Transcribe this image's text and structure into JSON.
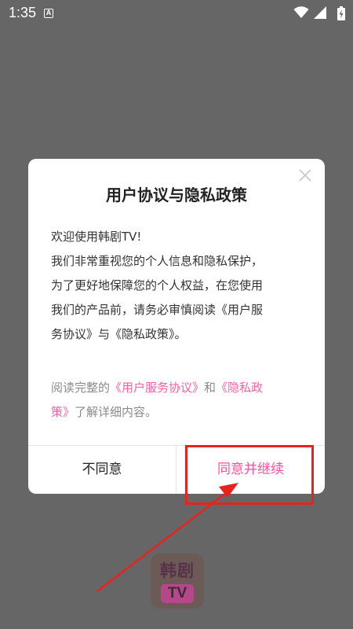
{
  "status_bar": {
    "time": "1:35",
    "notification_glyph": "A"
  },
  "dialog": {
    "title": "用户协议与隐私政策",
    "greeting": "欢迎使用韩剧TV!",
    "body_line_1": "我们非常重视您的个人信息和隐私保护，",
    "body_line_2": "为了更好地保障您的个人权益，在您使用",
    "body_line_3": "我们的产品前，请务必审慎阅读《用户服",
    "body_line_4": "务协议》与《隐私政策》。",
    "read_prefix": "阅读完整的",
    "user_agreement_link": "《用户服务协议》",
    "read_and": "和",
    "privacy_link_part1": "《隐私政",
    "privacy_link_part2": "策》",
    "read_suffix": "了解详细内容。",
    "disagree_label": "不同意",
    "agree_label": "同意并继续"
  },
  "app_logo": {
    "top_text": "韩剧",
    "badge_text": "TV"
  },
  "colors": {
    "link": "#ff5fa2",
    "agree": "#ff4f9a",
    "annotation": "#e8231f",
    "overlay": "#666666"
  },
  "icons": {
    "status": [
      "a-notification-icon",
      "wifi-icon",
      "signal-icon",
      "battery-icon"
    ],
    "dialog": [
      "close-icon"
    ]
  }
}
